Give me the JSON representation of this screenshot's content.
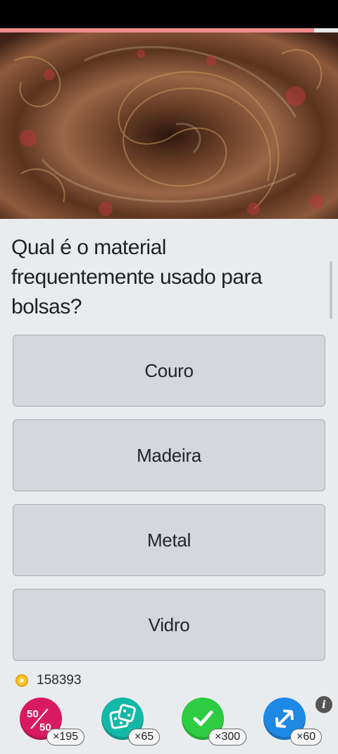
{
  "quiz": {
    "progress_fraction": 0.93,
    "question": "Qual é o material frequentemente usado para bolsas?",
    "answers": [
      "Couro",
      "Madeira",
      "Metal",
      "Vidro"
    ]
  },
  "footer": {
    "coins": "158393",
    "powerups": [
      {
        "name": "fifty-fifty",
        "icon": "50/50",
        "count": "×195",
        "color": "#d81b60"
      },
      {
        "name": "dice",
        "icon": "dice-icon",
        "count": "×65",
        "color": "#14b8a6"
      },
      {
        "name": "correct-answer",
        "icon": "check-icon",
        "count": "×300",
        "color": "#2ecc40"
      },
      {
        "name": "swap-question",
        "icon": "swap-icon",
        "count": "×60",
        "color": "#1e88e5"
      }
    ],
    "info_label": "i",
    "fifty_top": "50",
    "fifty_bottom": "50"
  }
}
